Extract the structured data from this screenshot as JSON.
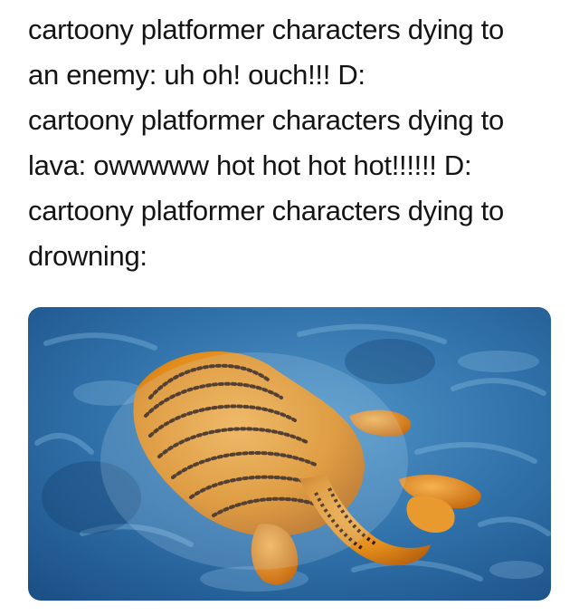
{
  "caption": {
    "lines": [
      "cartoony platformer characters dying to",
      "an enemy: uh oh! ouch!!! D:",
      "cartoony platformer characters dying to",
      "lava: owwwww hot hot hot hot!!!!!! D:",
      "cartoony platformer characters dying to",
      "drowning:"
    ]
  },
  "image": {
    "subject": "garfield-floating-face-down-in-water",
    "colors": {
      "water_dark": "#1f5c96",
      "water_light": "#5fa4cf",
      "fur": "#e8921f",
      "stripes": "#3a1a08"
    }
  }
}
